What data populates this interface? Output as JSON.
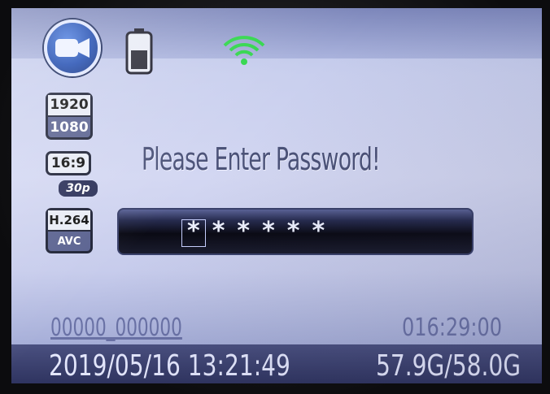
{
  "status_icons": {
    "mode_icon": "video-camera-icon",
    "battery_icon": "battery-icon",
    "wifi_icon": "wifi-icon"
  },
  "video_settings": {
    "resolution_width": "1920",
    "resolution_height": "1080",
    "aspect_ratio": "16:9",
    "frame_rate": "30p",
    "codec": "H.264",
    "codec_profile": "AVC"
  },
  "password_dialog": {
    "prompt": "Please Enter Password!",
    "masked_value": "******",
    "cursor_position": 1
  },
  "footer": {
    "file_name": "00000_000000",
    "recording_time": "016:29:00",
    "datetime": "2019/05/16 13:21:49",
    "storage": "57.9G/58.0G"
  },
  "colors": {
    "wifi": "#2fd64a",
    "accent": "#1f4bb0",
    "screen_bg": "#c9cfee"
  }
}
